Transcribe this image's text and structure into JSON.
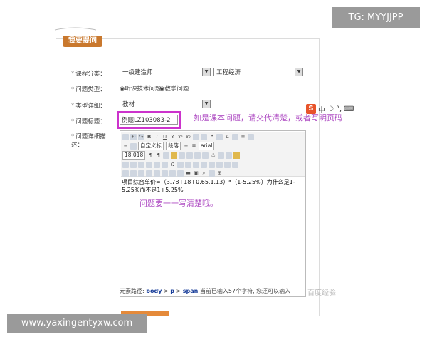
{
  "section_title": "我要提问",
  "form": {
    "category_label": "课程分类：",
    "category_primary": "一级建造师",
    "category_secondary": "工程经济",
    "type_label": "问题类型：",
    "type_option_1": "听课技术问题",
    "type_option_2": "教学问题",
    "type_detail_label": "类型详细：",
    "type_detail_value": "教材",
    "title_label": "问题标题：",
    "title_value": "例题LZ103083-2",
    "desc_label": "问题详细描述："
  },
  "toolbar": {
    "style_select": "自定义标",
    "para_select": "段落",
    "font_select": "arial",
    "size_select": "18.018"
  },
  "editor": {
    "content": "项目综合单价=（3.78+18+0.65.1.13）*（1-5.25%）为什么是1-5.25%而不是1+5.25%"
  },
  "statusbar": {
    "prefix": "元素路径:",
    "path_body": "body",
    "sep1": ">",
    "path_p": "p",
    "sep2": ">",
    "path_span": "span",
    "suffix": "当前已输入57个字符, 您还可以输入"
  },
  "annotations": {
    "note1": "如是课本问题，请交代清楚，或者写明页码",
    "note2": "问题要一一写清楚哦。"
  },
  "ime": {
    "s_icon": "S",
    "zh": "中"
  },
  "watermark": "百度经验",
  "badges": {
    "tg": "TG: MYYJJPP",
    "url": "www.yaxingentyxw.com"
  }
}
